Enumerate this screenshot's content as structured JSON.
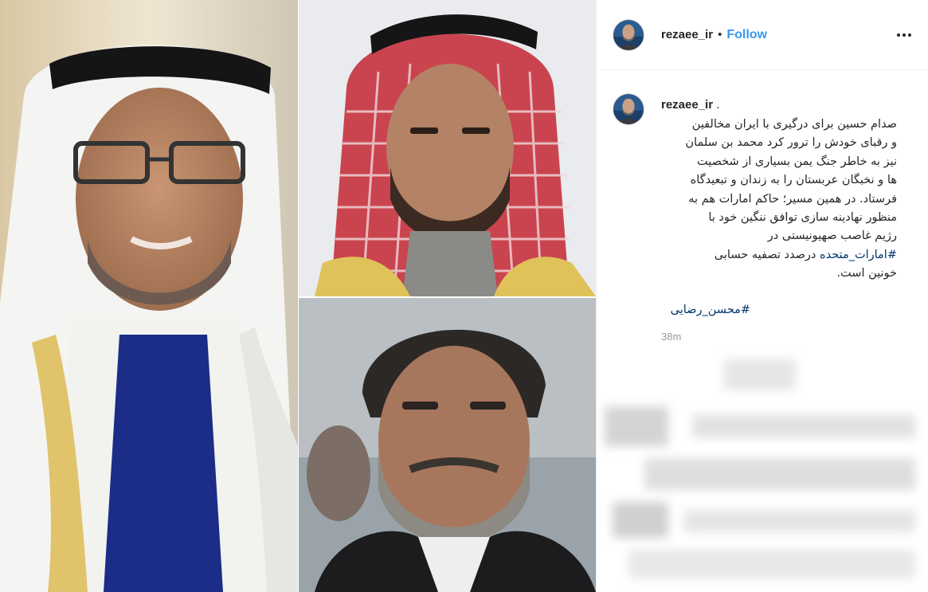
{
  "post": {
    "username": "rezaee_ir",
    "separator": "•",
    "follow_label": "Follow",
    "more_icon": "more-options-icon"
  },
  "caption": {
    "username": "rezaee_ir",
    "after_username": ".",
    "lines": [
      "صدام حسین برای درگیری با ایران مخالفین",
      "و رقبای خودش را ترور کرد محمد بن سلمان",
      "نیز به خاطر جنگ یمن بسیاری از شخصیت",
      "ها و نخبگان عربستان را به زندان و تبعیدگاه",
      "فرستاد. در همین مسیر؛ حاکم امارات هم به",
      "منظور نهادینه سازی توافق ننگین خود با",
      "رژیم غاصب صهیونیستی در"
    ],
    "hashtag_1": "#امارات_متحده",
    "line_after_hashtag": " درصدد تصفیه حسابی",
    "last_line": "خونین است.",
    "hashtag_2": "#محسن_رضایی",
    "time": "38m"
  },
  "colors": {
    "link_blue": "#3897f0",
    "hashtag": "#003569",
    "text": "#262626",
    "muted": "#999999"
  }
}
